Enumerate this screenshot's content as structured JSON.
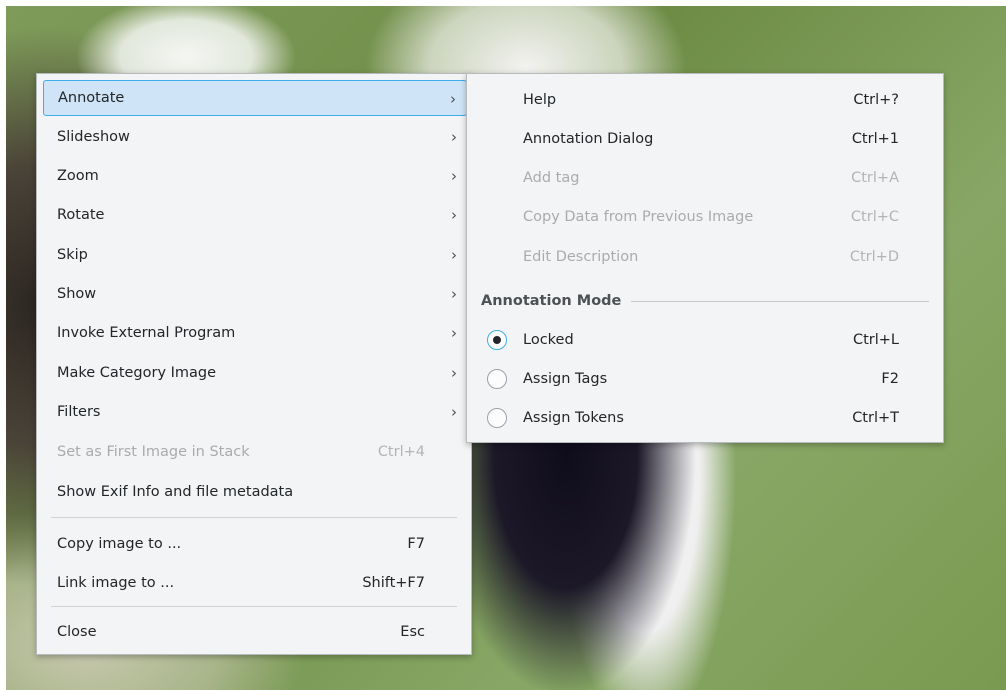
{
  "main_menu": {
    "items": [
      {
        "label": "Annotate",
        "submenu": true,
        "active": true
      },
      {
        "label": "Slideshow",
        "submenu": true
      },
      {
        "label": "Zoom",
        "submenu": true
      },
      {
        "label": "Rotate",
        "submenu": true
      },
      {
        "label": "Skip",
        "submenu": true
      },
      {
        "label": "Show",
        "submenu": true
      },
      {
        "label": "Invoke External Program",
        "submenu": true
      },
      {
        "label": "Make Category Image",
        "submenu": true
      },
      {
        "label": "Filters",
        "submenu": true
      },
      {
        "label": "Set as First Image in Stack",
        "shortcut": "Ctrl+4",
        "disabled": true
      },
      {
        "label": "Show Exif Info and file metadata"
      },
      {
        "label": "Copy image to ...",
        "shortcut": "F7"
      },
      {
        "label": "Link image to ...",
        "shortcut": "Shift+F7"
      },
      {
        "label": "Close",
        "shortcut": "Esc"
      }
    ],
    "arrow_glyph": "›"
  },
  "annotate_submenu": {
    "items": [
      {
        "label": "Help",
        "shortcut": "Ctrl+?"
      },
      {
        "label": "Annotation Dialog",
        "shortcut": "Ctrl+1"
      },
      {
        "label": "Add tag",
        "shortcut": "Ctrl+A",
        "disabled": true
      },
      {
        "label": "Copy Data from Previous Image",
        "shortcut": "Ctrl+C",
        "disabled": true
      },
      {
        "label": "Edit Description",
        "shortcut": "Ctrl+D",
        "disabled": true
      }
    ],
    "section_title": "Annotation Mode",
    "modes": [
      {
        "label": "Locked",
        "shortcut": "Ctrl+L",
        "checked": true
      },
      {
        "label": "Assign Tags",
        "shortcut": "F2",
        "checked": false
      },
      {
        "label": "Assign Tokens",
        "shortcut": "Ctrl+T",
        "checked": false
      }
    ]
  },
  "colors": {
    "highlight_fill": "#cfe4f6",
    "highlight_border": "#3daee9",
    "menu_background": "#f3f4f5",
    "disabled_text": "#a9abad"
  }
}
